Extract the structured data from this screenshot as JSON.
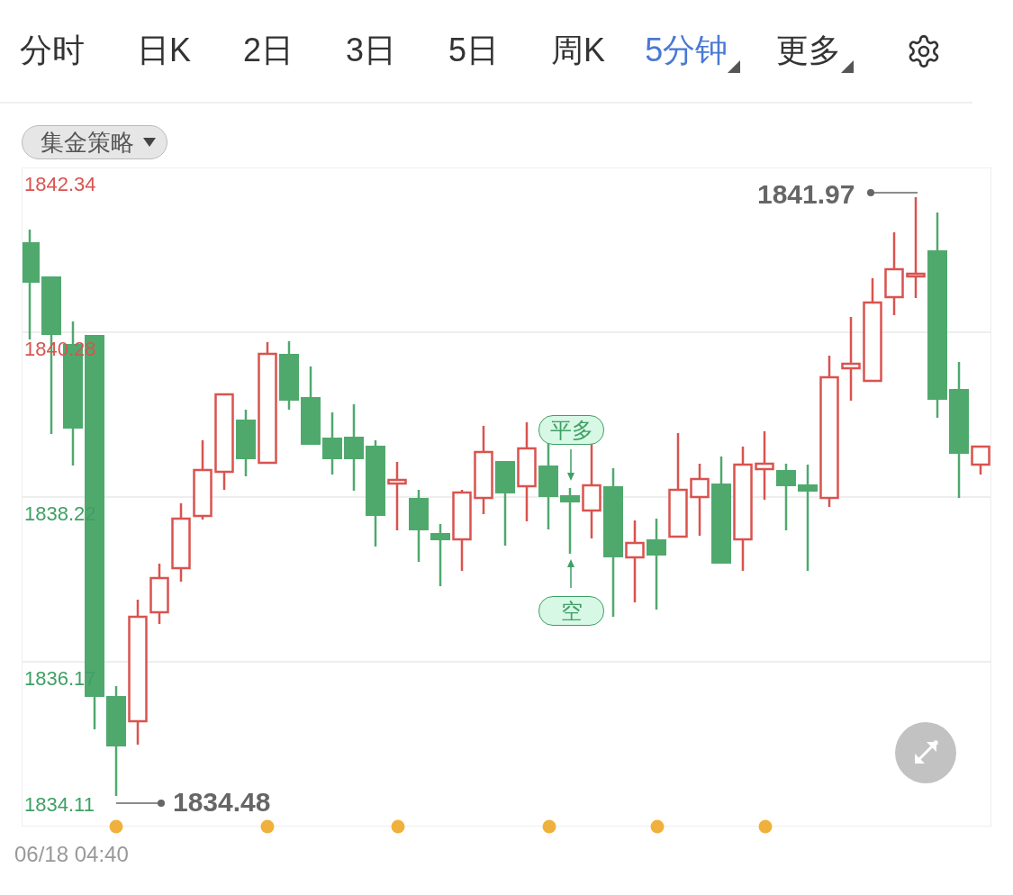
{
  "tabs": [
    {
      "label": "分时",
      "selected": false,
      "dropdown": false
    },
    {
      "label": "日K",
      "selected": false,
      "dropdown": false
    },
    {
      "label": "2日",
      "selected": false,
      "dropdown": false
    },
    {
      "label": "3日",
      "selected": false,
      "dropdown": false
    },
    {
      "label": "5日",
      "selected": false,
      "dropdown": false
    },
    {
      "label": "周K",
      "selected": false,
      "dropdown": false
    },
    {
      "label": "5分钟",
      "selected": true,
      "dropdown": true
    },
    {
      "label": "更多",
      "selected": false,
      "dropdown": true
    }
  ],
  "strategy_button": {
    "label": "集金策略"
  },
  "chart": {
    "y_axis_labels": [
      {
        "text": "1842.34",
        "color": "#d9534f"
      },
      {
        "text": "1840.28",
        "color": "#d9534f"
      },
      {
        "text": "1838.22",
        "color": "#3fa065"
      },
      {
        "text": "1836.17",
        "color": "#3fa065"
      },
      {
        "text": "1834.11",
        "color": "#3fa065"
      }
    ],
    "max_label": "1841.97",
    "min_label": "1834.48",
    "signals": [
      {
        "label": "平多",
        "kind": "above"
      },
      {
        "label": "空",
        "kind": "below"
      }
    ]
  },
  "timestamp": "06/18 04:40"
}
